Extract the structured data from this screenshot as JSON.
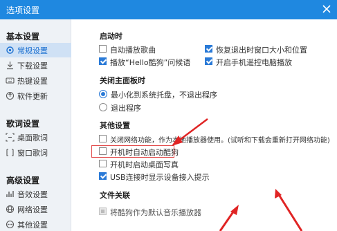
{
  "window": {
    "title": "选项设置"
  },
  "colors": {
    "titlebar": "#1f88e0",
    "accent": "#2a7ad7",
    "annotation": "#e02424"
  },
  "sidebar": {
    "groups": [
      {
        "title": "基本设置",
        "items": [
          {
            "label": "常规设置",
            "icon": "gear-icon",
            "active": true
          },
          {
            "label": "下载设置",
            "icon": "download-icon",
            "active": false
          },
          {
            "label": "热键设置",
            "icon": "keyboard-icon",
            "active": false
          },
          {
            "label": "软件更新",
            "icon": "update-icon",
            "active": false
          }
        ]
      },
      {
        "title": "歌词设置",
        "items": [
          {
            "label": "桌面歌词",
            "icon": "desktop-lyrics-icon",
            "active": false
          },
          {
            "label": "窗口歌词",
            "icon": "window-lyrics-icon",
            "active": false
          }
        ]
      },
      {
        "title": "高级设置",
        "items": [
          {
            "label": "音效设置",
            "icon": "sound-effect-icon",
            "active": false
          },
          {
            "label": "网络设置",
            "icon": "network-icon",
            "active": false
          },
          {
            "label": "其他设置",
            "icon": "other-settings-icon",
            "active": false
          }
        ]
      }
    ]
  },
  "main": {
    "startup": {
      "title": "启动时",
      "options": [
        {
          "label": "自动播放歌曲",
          "checked": false
        },
        {
          "label": "恢复退出时窗口大小和位置",
          "checked": true
        },
        {
          "label": "播放“Hello酷狗”问候语",
          "checked": true
        },
        {
          "label": "开启手机遥控电脑播放",
          "checked": true
        }
      ]
    },
    "close_panel": {
      "title": "关闭主面板时",
      "options": [
        {
          "label": "最小化到系统托盘，不退出程序",
          "selected": true
        },
        {
          "label": "退出程序",
          "selected": false
        }
      ]
    },
    "other": {
      "title": "其他设置",
      "options": [
        {
          "label": "关闭网络功能，作为本地播放器使用。(试听和下载会重新打开网络功能)",
          "checked": false
        },
        {
          "label": "开机时自动启动酷狗",
          "checked": false
        },
        {
          "label": "开机时启动桌面写真",
          "checked": false
        },
        {
          "label": "USB连接时显示设备接入提示",
          "checked": true
        }
      ]
    },
    "file_assoc": {
      "title": "文件关联",
      "options": [
        {
          "label": "将酷狗作为默认音乐播放器",
          "checked": false,
          "disabled": true
        }
      ]
    }
  }
}
